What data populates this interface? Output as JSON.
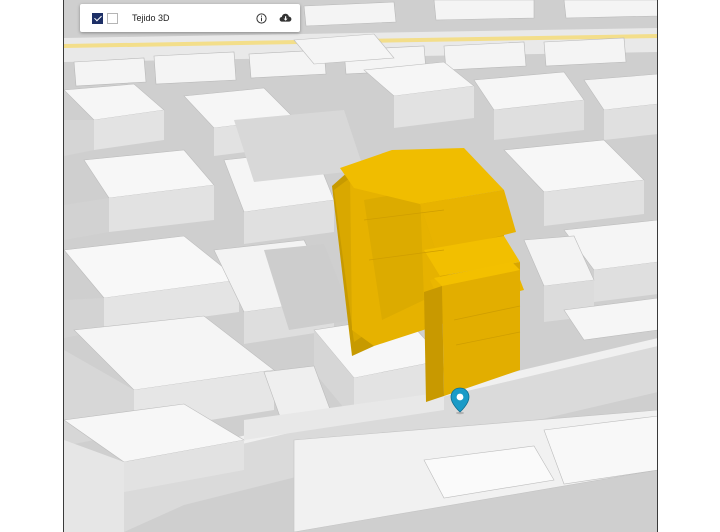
{
  "layer_control": {
    "layer_name": "Tejido 3D",
    "visible_checked": true,
    "info_icon": "info-icon",
    "download_icon": "cloud-download-icon"
  },
  "map": {
    "highlight_color": "#e8b400",
    "marker_color": "#1a9bc7",
    "marker_icon": "location-pin-icon"
  }
}
